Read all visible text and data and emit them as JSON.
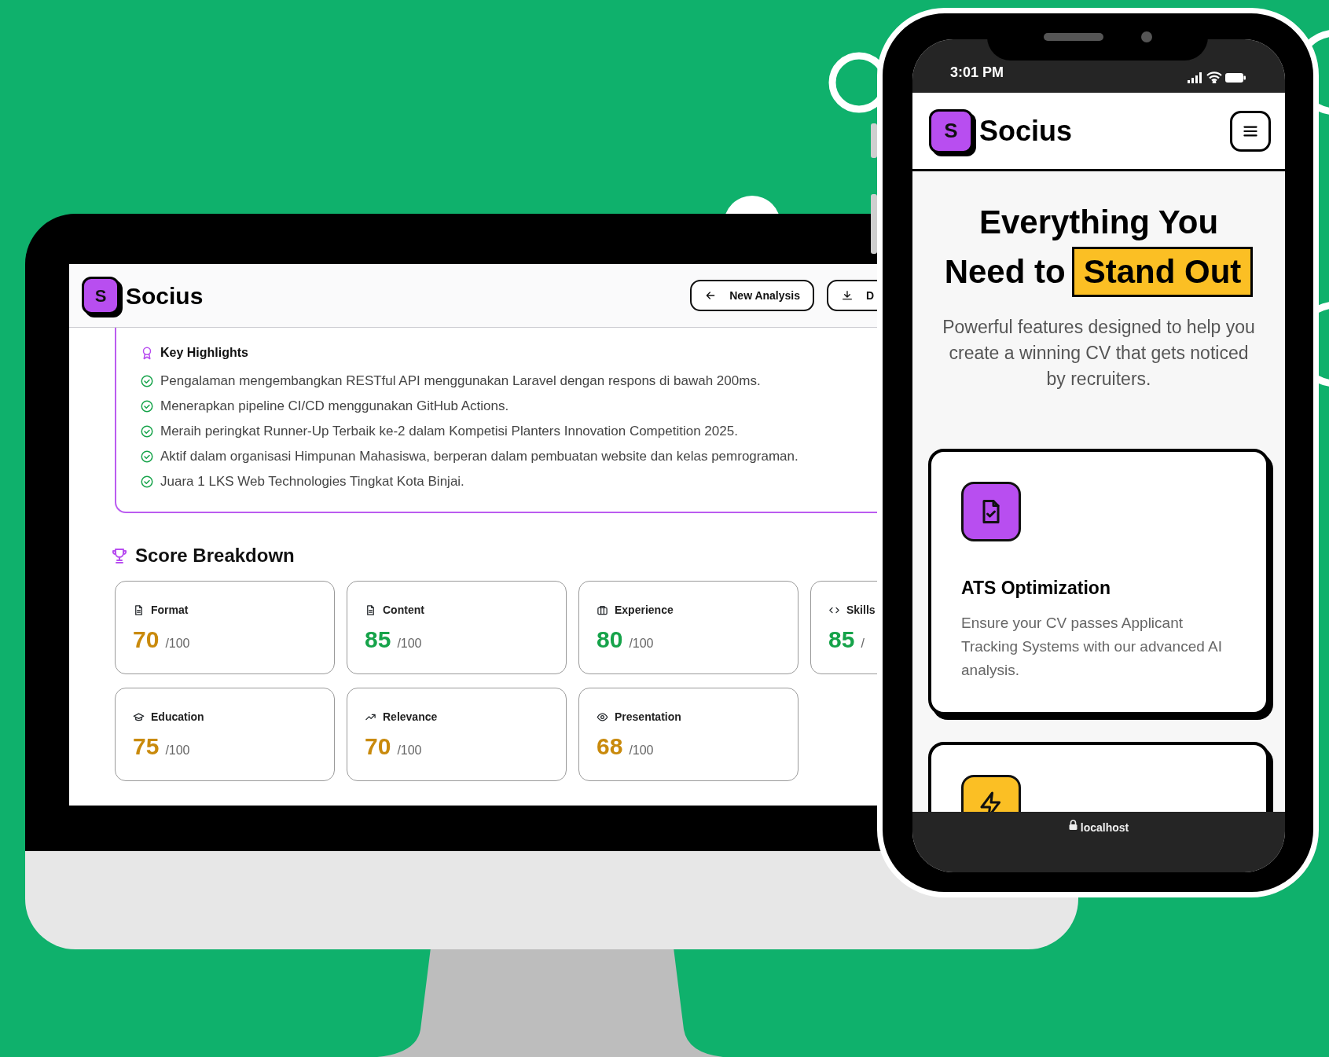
{
  "desktop": {
    "app_name": "Socius",
    "logo_letter": "S",
    "header_buttons": [
      {
        "label": "New Analysis"
      },
      {
        "label": "D"
      }
    ],
    "highlights": {
      "title": "Key Highlights",
      "items": [
        "Pengalaman mengembangkan RESTful API menggunakan Laravel dengan respons di bawah 200ms.",
        "Menerapkan pipeline CI/CD menggunakan GitHub Actions.",
        "Meraih peringkat Runner-Up Terbaik ke-2 dalam Kompetisi Planters Innovation Competition 2025.",
        "Aktif dalam organisasi Himpunan Mahasiswa, berperan dalam pembuatan website dan kelas pemrograman.",
        "Juara 1 LKS Web Technologies Tingkat Kota Binjai."
      ]
    },
    "score_breakdown": {
      "title": "Score Breakdown",
      "cards": [
        {
          "label": "Format",
          "score": "70",
          "out_of": "/100",
          "color": "#c98a0c"
        },
        {
          "label": "Content",
          "score": "85",
          "out_of": "/100",
          "color": "#16a34a"
        },
        {
          "label": "Experience",
          "score": "80",
          "out_of": "/100",
          "color": "#16a34a"
        },
        {
          "label": "Skills",
          "score": "85",
          "out_of": "/",
          "color": "#16a34a"
        },
        {
          "label": "Education",
          "score": "75",
          "out_of": "/100",
          "color": "#c98a0c"
        },
        {
          "label": "Relevance",
          "score": "70",
          "out_of": "/100",
          "color": "#c98a0c"
        },
        {
          "label": "Presentation",
          "score": "68",
          "out_of": "/100",
          "color": "#c98a0c"
        }
      ]
    }
  },
  "phone": {
    "status_bar": {
      "time": "3:01 PM"
    },
    "app_name": "Socius",
    "logo_letter": "S",
    "hero": {
      "title_lines": [
        "Everything You",
        "Need to"
      ],
      "highlight": "Stand Out",
      "subtitle": "Powerful features designed to help you create a winning CV that gets noticed by recruiters."
    },
    "features": [
      {
        "title": "ATS Optimization",
        "description": "Ensure your CV passes Applicant Tracking Systems with our advanced AI analysis.",
        "color": "#b84ef0"
      },
      {
        "color": "#fbbf24"
      }
    ],
    "address_bar": {
      "url": "localhost"
    }
  }
}
